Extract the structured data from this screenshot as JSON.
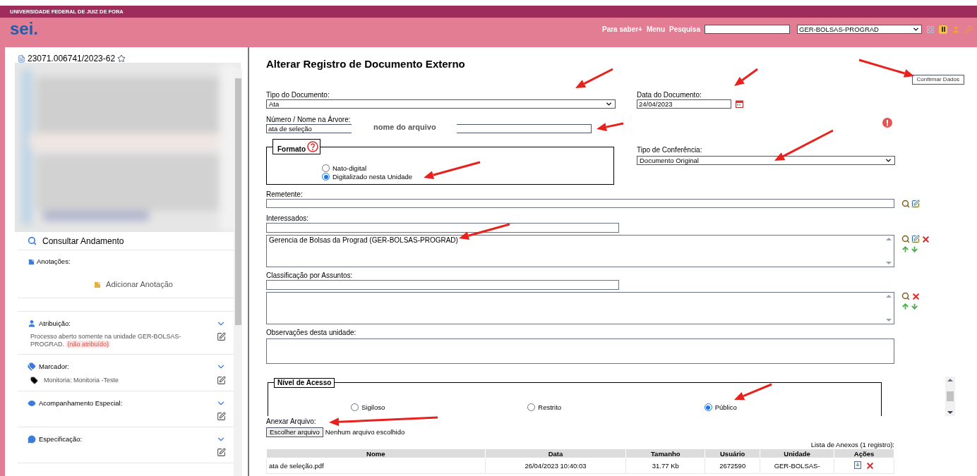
{
  "header": {
    "institution": "UNIVERSIDADE FEDERAL DE JUIZ DE FORA",
    "logo": "sei.",
    "links": [
      "Para saber+",
      "Menu",
      "Pesquisa"
    ],
    "unit": "GER-BOLSAS-PROGRAD"
  },
  "sidebar": {
    "process_number": "23071.006741/2023-62",
    "consult": "Consultar Andamento",
    "annotations": {
      "label": "Anotações:",
      "add": "Adicionar Anotação"
    },
    "sections": [
      {
        "kind": "assignment",
        "title": "Atribuição:",
        "text": "Processo aberto somente na unidade GER-BOLSAS-PROGRAD.",
        "badge": "(não atribuído)"
      },
      {
        "kind": "tag",
        "title": "Marcador:",
        "text": "Monitoria: Monitoria -Teste"
      },
      {
        "kind": "watch",
        "title": "Acompanhamento Especial:"
      },
      {
        "kind": "spec",
        "title": "Especificação:"
      }
    ]
  },
  "form": {
    "title": "Alterar Registro de Documento Externo",
    "confirm_button": "Confirmar Dados",
    "doc_type": {
      "label": "Tipo do Documento:",
      "value": "Ata"
    },
    "doc_date": {
      "label": "Data do Documento:",
      "value": "24/04/2023"
    },
    "number": {
      "label": "Número / Nome na Árvore:",
      "value": "ata de seleção",
      "hint": "nome do arquivo"
    },
    "format": {
      "legend": "Formato",
      "options": [
        {
          "label": "Nato-digital",
          "selected": false
        },
        {
          "label": "Digitalizado nesta Unidade",
          "selected": true
        }
      ]
    },
    "conference": {
      "label": "Tipo de Conferência:",
      "value": "Documento Original"
    },
    "sender": {
      "label": "Remetente:"
    },
    "interested": {
      "label": "Interessados:",
      "items": [
        "Gerencia de Bolsas da Prograd (GER-BOLSAS-PROGRAD)"
      ]
    },
    "subjects": {
      "label": "Classificação por Assuntos:"
    },
    "notes": {
      "label": "Observações desta unidade:"
    },
    "access": {
      "legend": "Nível de Acesso",
      "options": [
        {
          "label": "Sigiloso",
          "selected": false
        },
        {
          "label": "Restrito",
          "selected": false
        },
        {
          "label": "Público",
          "selected": true
        }
      ]
    },
    "attach": {
      "label": "Anexar Arquivo:",
      "button": "Escolher arquivo",
      "status": "Nenhum arquivo escolhido"
    },
    "attachments": {
      "caption": "Lista de Anexos (1 registro):",
      "columns": [
        "Nome",
        "Data",
        "Tamanho",
        "Usuário",
        "Unidade",
        "Ações"
      ],
      "rows": [
        {
          "cells": [
            "ata de seleção.pdf",
            "26/04/2023 10:40:03",
            "31.77 Kb",
            "2672590",
            "GER-BOLSAS-"
          ]
        }
      ]
    }
  }
}
